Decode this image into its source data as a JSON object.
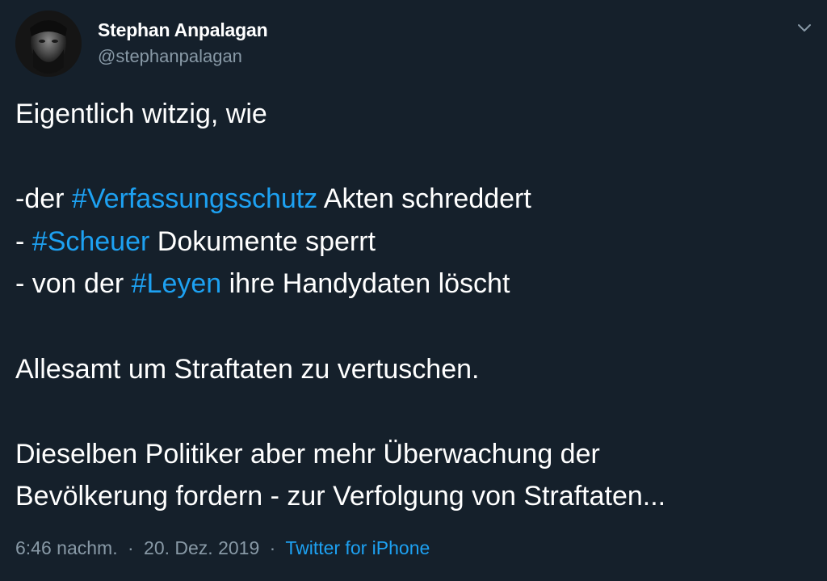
{
  "author": {
    "display_name": "Stephan Anpalagan",
    "handle": "@stephanpalagan"
  },
  "tweet": {
    "line1": "Eigentlich witzig, wie",
    "line2": {
      "prefix": "-der ",
      "hashtag": "#Verfassungsschutz",
      "suffix": " Akten schreddert"
    },
    "line3": {
      "prefix": "- ",
      "hashtag": "#Scheuer",
      "suffix": " Dokumente sperrt"
    },
    "line4": {
      "prefix": "- von der ",
      "hashtag": "#Leyen",
      "suffix": " ihre Handydaten löscht"
    },
    "line5": "Allesamt um Straftaten zu vertuschen.",
    "line6": "Dieselben Politiker aber mehr Überwachung der",
    "line7": "Bevölkerung fordern - zur Verfolgung von Straftaten..."
  },
  "meta": {
    "time": "6:46 nachm.",
    "separator": "·",
    "date": "20. Dez. 2019",
    "source": "Twitter for iPhone"
  },
  "icons": {
    "menu": "chevron-down-icon",
    "avatar": "avatar"
  },
  "colors": {
    "background": "#15202b",
    "text": "#ffffff",
    "secondary": "#8899a6",
    "link": "#1da1f2"
  }
}
